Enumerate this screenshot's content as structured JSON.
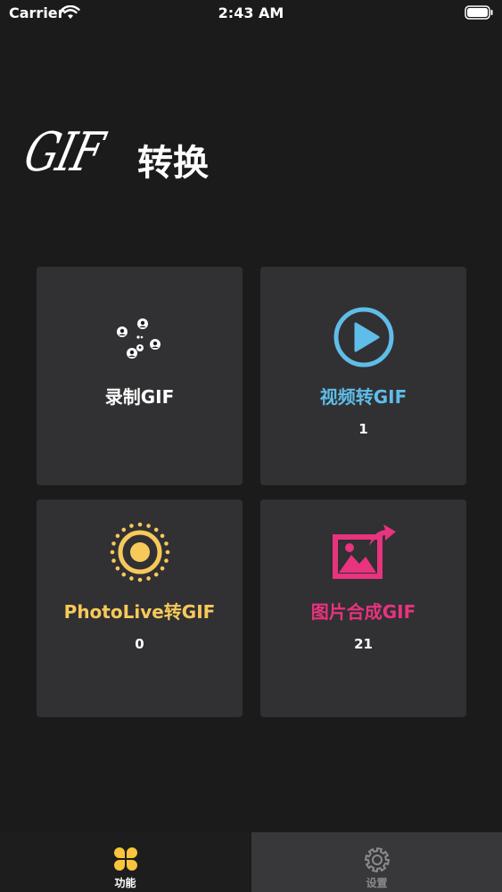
{
  "status_bar": {
    "carrier": "Carrier",
    "time": "2:43 AM"
  },
  "header": {
    "title_gif": "GIF",
    "title_cn": "转换"
  },
  "cards": {
    "record": {
      "label": "录制GIF",
      "label_color": "#ffffff"
    },
    "video": {
      "label": "视频转GIF",
      "count": "1",
      "label_color": "#5fbde9"
    },
    "live": {
      "label": "PhotoLive转GIF",
      "count": "0",
      "label_color": "#f7c95b"
    },
    "images": {
      "label": "图片合成GIF",
      "count": "21",
      "label_color": "#e8337e"
    }
  },
  "tab_bar": {
    "functions_label": "功能",
    "settings_label": "设置",
    "active_color": "#f8c53c"
  }
}
